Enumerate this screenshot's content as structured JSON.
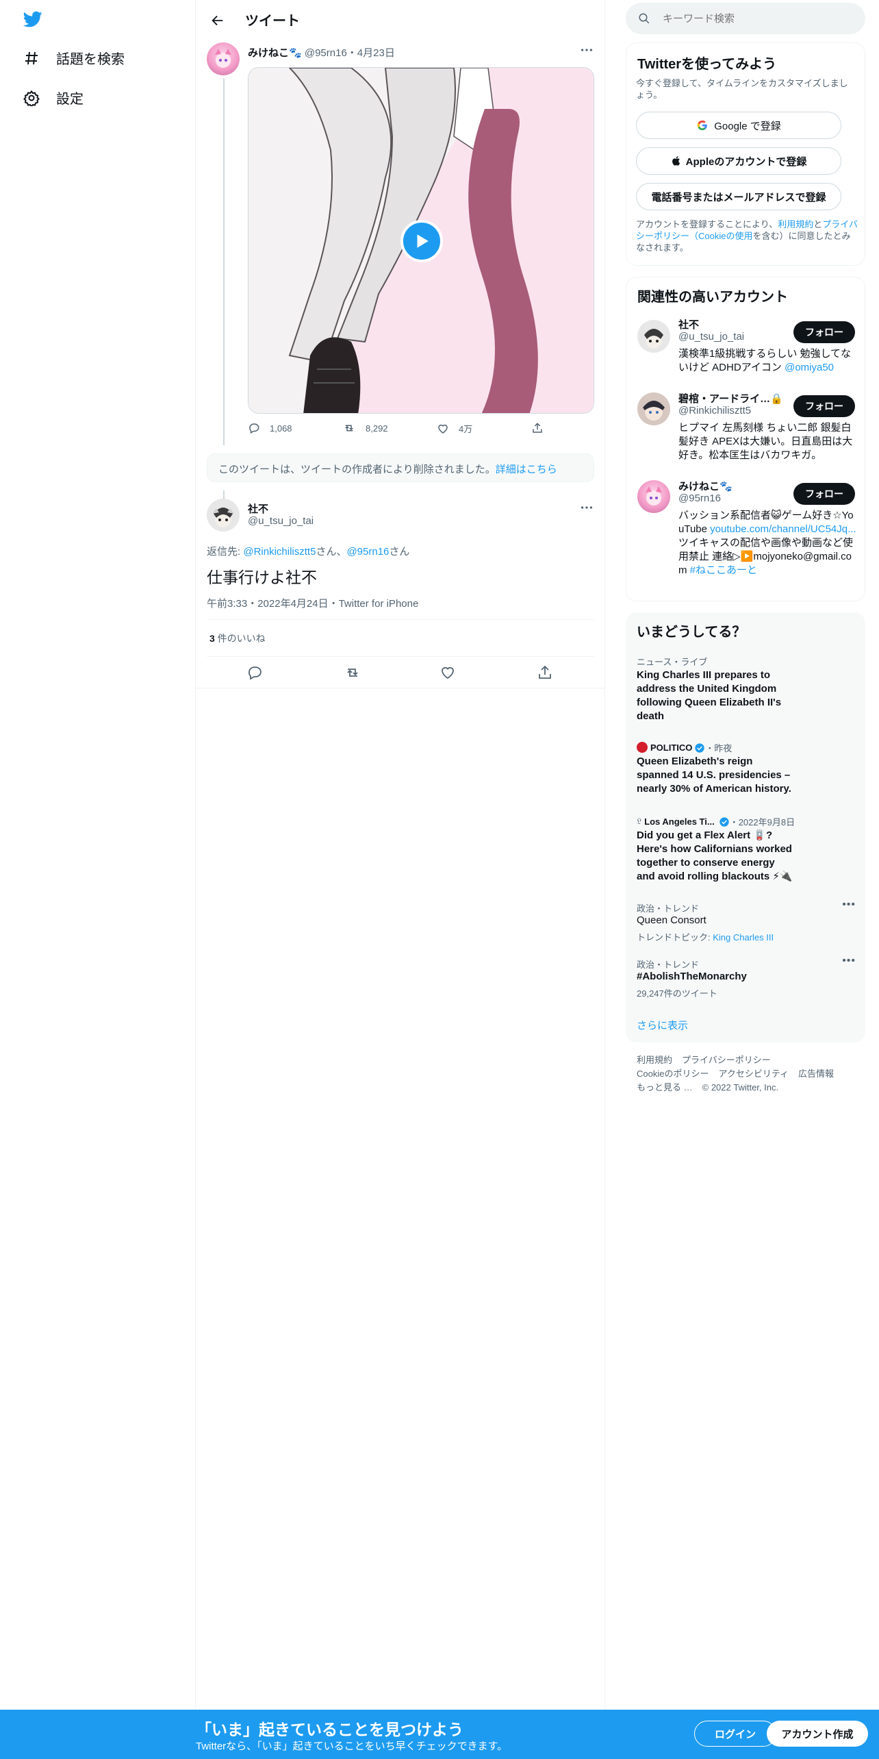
{
  "nav": {
    "explore_label": "話題を検索",
    "settings_label": "設定"
  },
  "header": {
    "title": "ツイート"
  },
  "parent_tweet": {
    "name": "みけねこ🐾",
    "handle": "@95rn16",
    "date": "・4月23日",
    "replies": "1,068",
    "retweets": "8,292",
    "likes": "4万",
    "media_colors": {
      "bg": "#fbe3ee",
      "tail": "#a85c78"
    }
  },
  "deleted_notice": {
    "text": "このツイートは、ツイートの作成者により削除されました。",
    "link": "詳細はこちら"
  },
  "main_tweet": {
    "name": "社不",
    "handle": "@u_tsu_jo_tai",
    "reply_prefix": "返信先: ",
    "reply_to_1": "@Rinkichilisztt5",
    "reply_sep_1": "さん、",
    "reply_to_2": "@95rn16",
    "reply_sep_2": "さん",
    "text": "仕事行けよ社不",
    "timestamp": "午前3:33・2022年4月24日・Twitter for iPhone",
    "likes_count": "3",
    "likes_label": " 件のいいね"
  },
  "search": {
    "placeholder": "キーワード検索"
  },
  "signup": {
    "title": "Twitterを使ってみよう",
    "subtitle": "今すぐ登録して、タイムラインをカスタマイズしましょう。",
    "google": "Google で登録",
    "apple": "Appleのアカウントで登録",
    "phone": "電話番号またはメールアドレスで登録",
    "terms_1": "アカウントを登録することにより、",
    "terms_link_1": "利用規約",
    "terms_2": "と",
    "terms_link_2": "プライバシーポリシー（Cookieの使用",
    "terms_3": "を含む）に同意したとみなされます。"
  },
  "related": {
    "title": "関連性の高いアカウント",
    "follow_label": "フォロー",
    "accounts": [
      {
        "name": "社不",
        "handle": "@u_tsu_jo_tai",
        "bio": "漢検準1級挑戦するらしい 勉強してないけど ADHDアイコン ",
        "bio_link": "@omiya50"
      },
      {
        "name": "碧棺・アードライ…🔒",
        "handle": "@Rinkichilisztt5",
        "bio": "ヒプマイ 左馬刻様 ちょい二郎 銀髪白髪好き APEXは大嫌い。日直島田は大好き。松本匡生はバカワキガ。",
        "bio_link": ""
      },
      {
        "name": "みけねこ🐾",
        "handle": "@95rn16",
        "bio": "バッション系配信者😺ゲーム好き☆YouTube ",
        "bio_link": "youtube.com/channel/UC54Jq...",
        "bio_2": "ツイキャスの配信や画像や動画など使用禁止 連絡▷▶️mojyoneko@gmail.com ",
        "bio_link_2": "#ねここあーと"
      }
    ]
  },
  "trends": {
    "title": "いまどうしてる？",
    "items": [
      {
        "meta": "ニュース・ライブ",
        "title": "King Charles III prepares to address the United Kingdom following Queen Elizabeth II's death"
      },
      {
        "meta_source": "POLITICO",
        "meta_time": "・昨夜",
        "title": "Queen Elizabeth's reign spanned 14 U.S. presidencies – nearly 30% of American history."
      },
      {
        "meta_source": "Los Angeles Ti...",
        "meta_time": "・2022年9月8日",
        "title": "Did you get a Flex Alert 🪫? Here's how Californians worked together to conserve energy and avoid rolling blackouts ⚡🔌"
      },
      {
        "meta": "政治・トレンド",
        "title": "Queen Consort",
        "sub_prefix": "トレンドトピック: ",
        "sub_link": "King Charles III"
      },
      {
        "meta": "政治・トレンド",
        "title": "#AbolishTheMonarchy",
        "sub": "29,247件のツイート"
      }
    ],
    "show_more": "さらに表示"
  },
  "footer": {
    "links_1": [
      "利用規約",
      "プライバシーポリシー"
    ],
    "links_2": [
      "Cookieのポリシー",
      "アクセシビリティ",
      "広告情報"
    ],
    "more": "もっと見る …",
    "copyright": "© 2022 Twitter, Inc."
  },
  "banner": {
    "title": "「いま」起きていることを見つけよう",
    "subtitle": "Twitterなら、「いま」起きていることをいち早くチェックできます。",
    "login": "ログイン",
    "create": "アカウント作成"
  },
  "colors": {
    "brand": "#1d9bf0",
    "text": "#0f1419",
    "muted": "#536471"
  }
}
